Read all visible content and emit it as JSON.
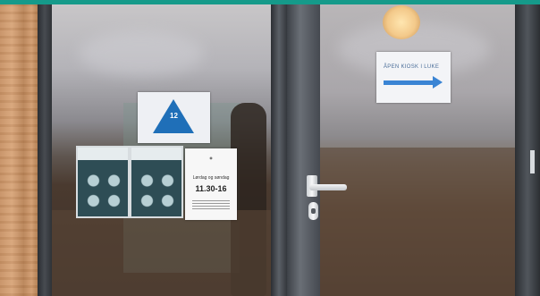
{
  "scene": {
    "description_colors": {
      "banner": "#159a8a",
      "sign_blue": "#1f6fb8",
      "arrow_blue": "#3a84d4"
    }
  },
  "triangle_sign": {
    "number": "12"
  },
  "hours_sign": {
    "days": "Lørdag og søndag",
    "time": "11.30-16"
  },
  "direction_sign": {
    "text": "ÅPEN KIOSK I LUKE"
  }
}
